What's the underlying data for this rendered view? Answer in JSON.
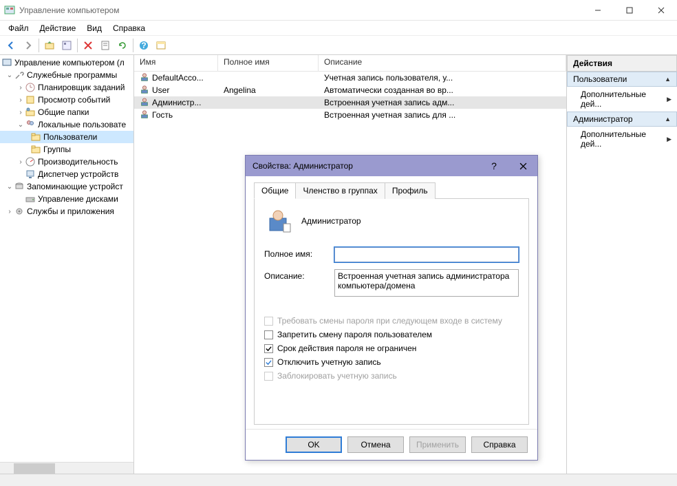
{
  "window": {
    "title": "Управление компьютером"
  },
  "menu": {
    "file": "Файл",
    "action": "Действие",
    "view": "Вид",
    "help": "Справка"
  },
  "tree": {
    "root": "Управление компьютером (л",
    "service_programs": "Служебные программы",
    "task_scheduler": "Планировщик заданий",
    "event_viewer": "Просмотр событий",
    "shared_folders": "Общие папки",
    "local_users": "Локальные пользовате",
    "users": "Пользователи",
    "groups": "Группы",
    "performance": "Производительность",
    "device_manager": "Диспетчер устройств",
    "storage": "Запоминающие устройст",
    "disk_mgmt": "Управление дисками",
    "services_apps": "Службы и приложения"
  },
  "list": {
    "columns": {
      "name": "Имя",
      "fullname": "Полное имя",
      "desc": "Описание"
    },
    "rows": [
      {
        "name": "DefaultAcco...",
        "fullname": "",
        "desc": "Учетная запись пользователя, у..."
      },
      {
        "name": "User",
        "fullname": "Angelina",
        "desc": "Автоматически созданная во вр..."
      },
      {
        "name": "Администр...",
        "fullname": "",
        "desc": "Встроенная учетная запись адм..."
      },
      {
        "name": "Гость",
        "fullname": "",
        "desc": "Встроенная учетная запись для ..."
      }
    ]
  },
  "actions": {
    "header": "Действия",
    "group1": "Пользователи",
    "more1": "Дополнительные дей...",
    "group2": "Администратор",
    "more2": "Дополнительные дей..."
  },
  "dialog": {
    "title": "Свойства: Администратор",
    "help": "?",
    "tabs": {
      "general": "Общие",
      "membership": "Членство в группах",
      "profile": "Профиль"
    },
    "username": "Администратор",
    "fullname_label": "Полное имя:",
    "fullname_value": "",
    "desc_label": "Описание:",
    "desc_value": "Встроенная учетная запись администратора компьютера/домена",
    "checks": {
      "must_change": "Требовать смены пароля при следующем входе в систему",
      "cannot_change": "Запретить смену пароля пользователем",
      "never_expires": "Срок действия пароля не ограничен",
      "disabled": "Отключить учетную запись",
      "locked": "Заблокировать учетную запись"
    },
    "buttons": {
      "ok": "OK",
      "cancel": "Отмена",
      "apply": "Применить",
      "help": "Справка"
    }
  }
}
